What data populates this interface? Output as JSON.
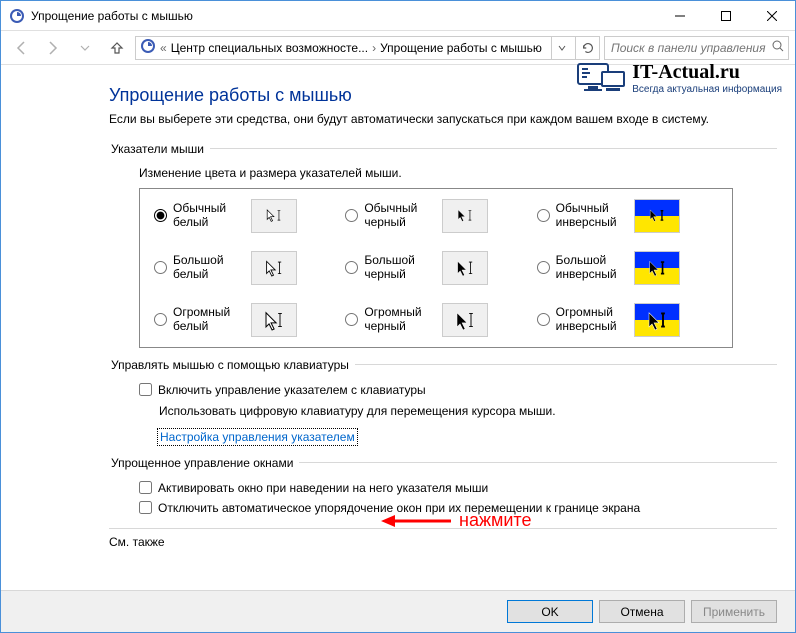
{
  "titlebar": {
    "title": "Упрощение работы с мышью"
  },
  "nav": {
    "crumb1": "Центр специальных возможносте...",
    "crumb2": "Упрощение работы с мышью",
    "search_placeholder": "Поиск в панели управления"
  },
  "watermark": {
    "site": "IT-Actual.ru",
    "tagline": "Всегда актуальная информация"
  },
  "page": {
    "title": "Упрощение работы с мышью",
    "desc": "Если вы выберете эти средства, они будут автоматически запускаться при каждом вашем входе в систему."
  },
  "pointers": {
    "legend": "Указатели мыши",
    "hint": "Изменение цвета и размера указателей мыши.",
    "opts": {
      "nw": "Обычный белый",
      "nb": "Обычный черный",
      "ni": "Обычный инверсный",
      "lw": "Большой белый",
      "lb": "Большой черный",
      "li": "Большой инверсный",
      "hw": "Огромный белый",
      "hb": "Огромный черный",
      "hi": "Огромный инверсный"
    }
  },
  "keyboard": {
    "legend": "Управлять мышью с помощью клавиатуры",
    "chk": "Включить управление указателем с клавиатуры",
    "sub": "Использовать цифровую клавиатуру для перемещения курсора мыши.",
    "link": "Настройка управления указателем"
  },
  "windows": {
    "legend": "Упрощенное управление окнами",
    "chk1": "Активировать окно при наведении на него указателя мыши",
    "chk2": "Отключить автоматическое упорядочение окон при их перемещении к границе экрана"
  },
  "see_also": "См. также",
  "buttons": {
    "ok": "OK",
    "cancel": "Отмена",
    "apply": "Применить"
  },
  "annotation": "нажмите"
}
